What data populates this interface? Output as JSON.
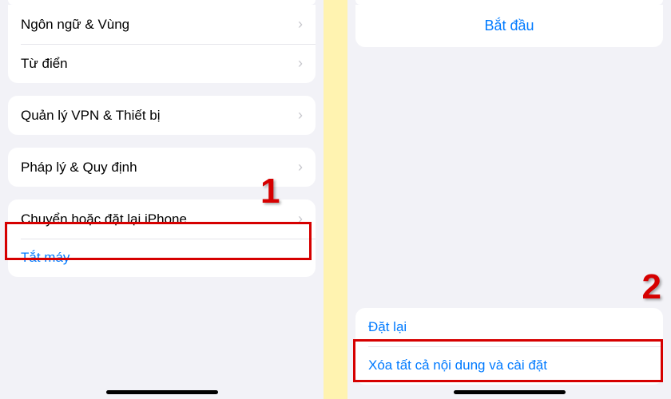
{
  "left": {
    "language_region": "Ngôn ngữ & Vùng",
    "dictionary": "Từ điển",
    "vpn_device": "Quản lý VPN & Thiết bị",
    "legal": "Pháp lý & Quy định",
    "transfer_reset": "Chuyển hoặc đặt lại iPhone",
    "shutdown": "Tắt máy"
  },
  "right": {
    "start": "Bắt đầu",
    "reset": "Đặt lại",
    "erase_all": "Xóa tất cả nội dung và cài đặt"
  },
  "markers": {
    "one": "1",
    "two": "2"
  }
}
